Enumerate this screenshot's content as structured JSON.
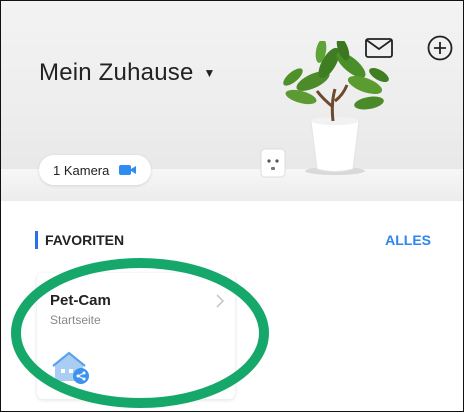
{
  "header": {
    "title": "Mein Zuhause",
    "messages_icon": "envelope-icon",
    "add_icon": "plus-circle-icon"
  },
  "camera_pill": {
    "label": "1 Kamera",
    "icon": "video-camera-icon",
    "icon_color": "#2f8cf0"
  },
  "favorites": {
    "title": "FAVORITEN",
    "link": "ALLES",
    "accent": "#2c6ef2",
    "link_color": "#2c86f2"
  },
  "device_card": {
    "name": "Pet-Cam",
    "room": "Startseite",
    "icon": "home-share-icon"
  },
  "annotation": {
    "color": "#16a86a"
  }
}
